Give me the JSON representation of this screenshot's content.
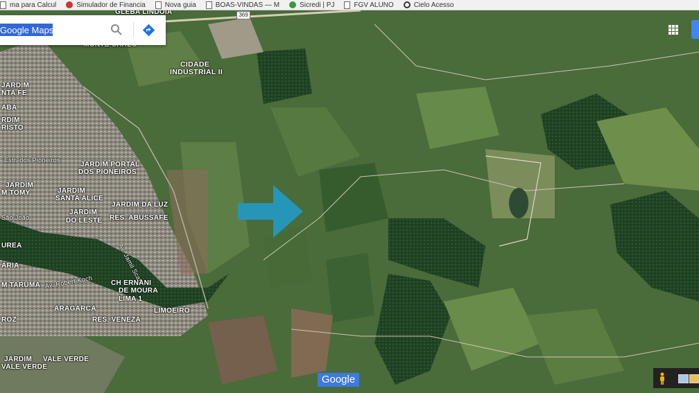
{
  "bookmarks": [
    {
      "label": "ma para Calcul",
      "icon": "page-icon"
    },
    {
      "label": "Simulador de Financia",
      "icon": "bank-icon"
    },
    {
      "label": "Nova guia",
      "icon": "page-icon"
    },
    {
      "label": "BOAS-VINDAS — M",
      "icon": "page-icon"
    },
    {
      "label": "Sicredi | PJ",
      "icon": "sicredi-icon"
    },
    {
      "label": "FGV ALUNO",
      "icon": "page-icon"
    },
    {
      "label": "Cielo Acesso",
      "icon": "cielo-icon"
    }
  ],
  "search": {
    "value": "Google Maps"
  },
  "map": {
    "road_shield": "369",
    "labels": {
      "global_lindoia": "GLEBA LINDOIA",
      "pq_top": "MONTE CARLO",
      "cidade_industrial_1": "CIDADE",
      "cidade_industrial_2": "INDUSTRIAL II",
      "santa_fe_1": "JARDIM",
      "santa_fe_2": "NTA FE",
      "aba": "ABÁ",
      "jardim_left": "RDIM",
      "cristo": "RISTO",
      "estr_pioneiros": "Estr. dos Pioneiros",
      "portal_1": "JARDIM PORTAL",
      "portal_2": "DOS PIONEIROS",
      "tomy_1": "JARDIM",
      "tomy_2": "M TOMY",
      "santa_alice_1": "JARDIM",
      "santa_alice_2": "SANTA ALICE",
      "leste_1": "JARDIM",
      "leste_2": "DO LESTE",
      "sao_joao": "São João",
      "da_luz": "JARDIM DA LUZ",
      "abussafe": "RES. ABUSSAFE",
      "amil_scaff": "Av. Jamil Scaff",
      "urea": "UREA",
      "aria": "ÁRIA",
      "taruma": "M TARUMA",
      "robert_koch": "Av. Robert Koch",
      "ernani_1": "CH ERNANI",
      "ernani_2": "DE MOURA",
      "ernani_3": "LIMA 1",
      "aragarca": "ARAGARCA",
      "veneza": "RES. VENEZA",
      "limoeiro": "LIMOEIRO",
      "roz": "ROZ",
      "vale_verde_1": "JARDIM",
      "vale_verde_2": "VALE VERDE",
      "vale_verde_3": "VALE VERDE"
    }
  },
  "footer": {
    "google_logo": "Google"
  },
  "colors": {
    "arrow": "#2596b8",
    "search_highlight": "#3367d6",
    "apps_tab": "#4285f4"
  }
}
